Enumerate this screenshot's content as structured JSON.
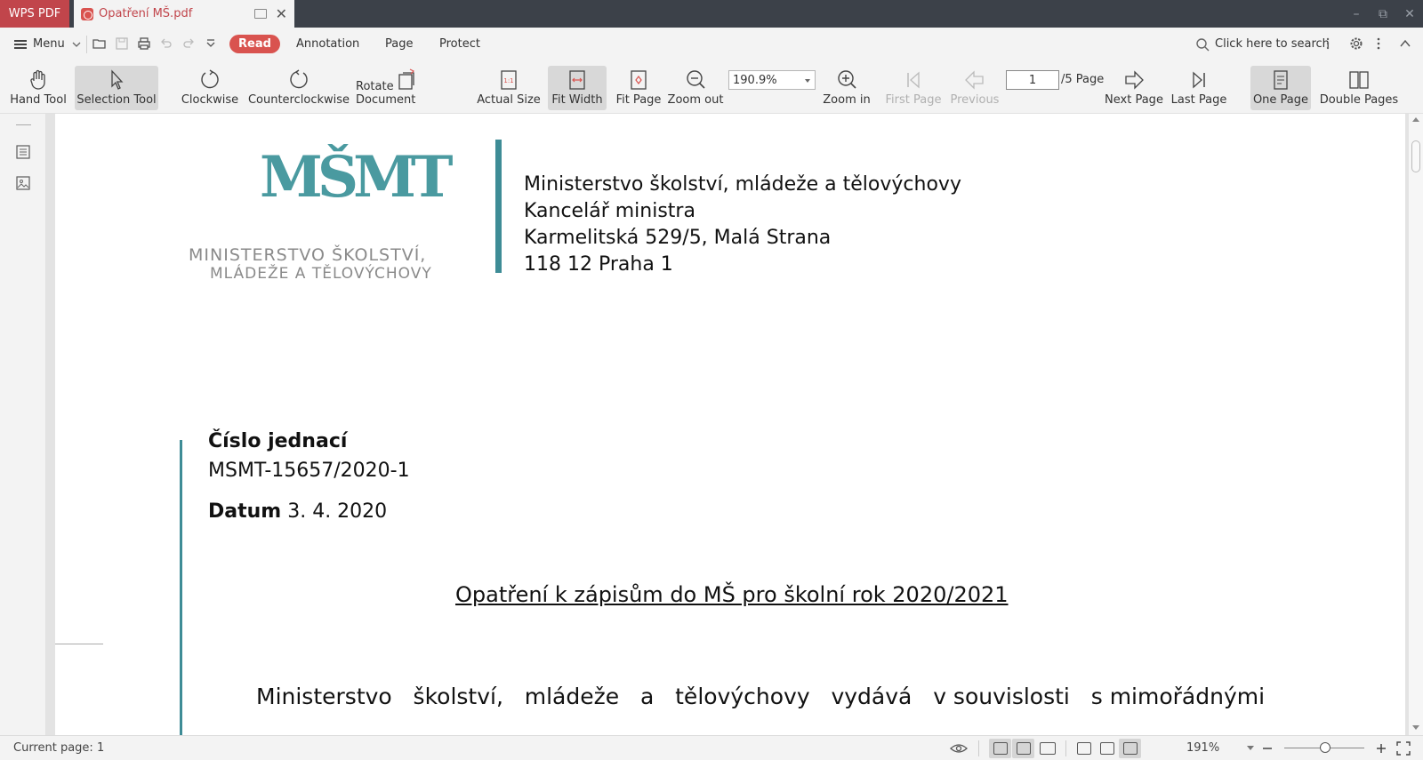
{
  "titlebar": {
    "app_tab": "WPS PDF",
    "doc_tab": "Opatření MŠ.pdf",
    "close_glyph": "✕",
    "minimize_glyph": "–",
    "restore_glyph": "⧉",
    "window_close_glyph": "✕"
  },
  "menubar": {
    "menu": "Menu",
    "tabs": [
      "Read",
      "Annotation",
      "Page",
      "Protect"
    ],
    "search_placeholder": "Click here to search"
  },
  "toolbar": {
    "hand_tool": "Hand Tool",
    "selection_tool": "Selection Tool",
    "clockwise": "Clockwise",
    "counterclockwise": "Counterclockwise",
    "rotate_document": "Rotate Document",
    "actual_size": "Actual Size",
    "fit_width": "Fit Width",
    "fit_page": "Fit Page",
    "zoom_out": "Zoom out",
    "zoom_value": "190.9%",
    "zoom_in": "Zoom in",
    "first_page": "First Page",
    "previous": "Previous",
    "page_input": "1",
    "page_total": "/5 Page",
    "next_page": "Next Page",
    "last_page": "Last Page",
    "one_page": "One Page",
    "double_pages": "Double Pages"
  },
  "document": {
    "logo_letters": "MŠMT",
    "logo_line1": "MINISTERSTVO ŠKOLSTVÍ,",
    "logo_line2": "MLÁDEŽE A TĚLOVÝCHOVY",
    "address": [
      "Ministerstvo školství, mládeže a tělovýchovy",
      "Kancelář ministra",
      "Karmelitská 529/5, Malá Strana",
      "118 12 Praha 1"
    ],
    "ref_label": "Číslo jednací",
    "ref_value": "MSMT-15657/2020-1",
    "date_label": "Datum",
    "date_value": "3. 4. 2020",
    "heading": "Opatření k zápisům do MŠ pro školní rok 2020/2021",
    "body_line1": "Ministerstvo   školství,   mládeže   a   tělovýchovy   vydává   v souvislosti   s mimořádnými"
  },
  "statusbar": {
    "current_page": "Current page: 1",
    "zoom": "191%"
  },
  "colors": {
    "accent_red": "#d9534f",
    "brand_teal": "#4a9aa0"
  }
}
